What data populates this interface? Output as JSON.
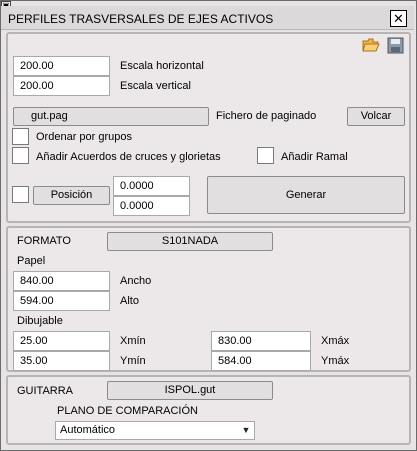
{
  "window": {
    "title": "PERFILES TRASVERSALES DE EJES ACTIVOS"
  },
  "icons": {
    "open": "folder-open-icon",
    "save": "floppy-save-icon",
    "close": "close-icon",
    "pin": "pin-icon"
  },
  "general": {
    "escala_h_value": "200.00",
    "escala_h_label": "Escala horizontal",
    "escala_v_value": "200.00",
    "escala_v_label": "Escala vertical",
    "fichero_value": "gut.pag",
    "fichero_label": "Fichero de paginado",
    "volcar_label": "Volcar",
    "ordenar_label": "Ordenar por grupos",
    "acuerdos_label": "Añadir Acuerdos de cruces y glorietas",
    "ramal_label": "Añadir Ramal",
    "posicion_label": "Posición",
    "pos_x": "0.0000",
    "pos_y": "0.0000",
    "generar_label": "Generar"
  },
  "formato": {
    "label": "FORMATO",
    "value": "S101NADA",
    "papel_label": "Papel",
    "ancho_value": "840.00",
    "ancho_label": "Ancho",
    "alto_value": "594.00",
    "alto_label": "Alto",
    "dibujable_label": "Dibujable",
    "xmin_value": "25.00",
    "xmin_label": "Xmín",
    "xmax_value": "830.00",
    "xmax_label": "Xmáx",
    "ymin_value": "35.00",
    "ymin_label": "Ymín",
    "ymax_value": "584.00",
    "ymax_label": "Ymáx"
  },
  "guitarra": {
    "label": "GUITARRA",
    "value": "ISPOL.gut",
    "plano_label": "PLANO DE COMPARACIÓN",
    "plano_selected": "Automático"
  }
}
